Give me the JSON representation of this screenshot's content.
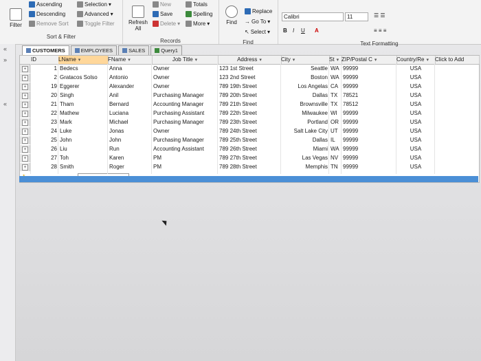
{
  "ribbon": {
    "sort_filter": {
      "filter": "Filter",
      "ascending": "Ascending",
      "descending": "Descending",
      "remove_sort": "Remove Sort",
      "selection": "Selection",
      "advanced": "Advanced",
      "toggle_filter": "Toggle Filter",
      "group": "Sort & Filter"
    },
    "records": {
      "refresh": "Refresh",
      "refresh_all": "All",
      "new": "New",
      "save": "Save",
      "delete": "Delete",
      "totals": "Totals",
      "spelling": "Spelling",
      "more": "More",
      "group": "Records"
    },
    "find": {
      "find": "Find",
      "replace": "Replace",
      "goto": "Go To",
      "select": "Select",
      "group": "Find"
    },
    "text_formatting": {
      "font": "Calibri",
      "size": "11",
      "bold": "B",
      "italic": "I",
      "underline": "U",
      "font_color_letter": "A",
      "group": "Text Formatting"
    }
  },
  "nav": {
    "collapse": "«",
    "arrows": "»",
    "left_mark": "«"
  },
  "tabs": [
    {
      "label": "CUSTOMERS",
      "active": true
    },
    {
      "label": "EMPLOYEES",
      "active": false
    },
    {
      "label": "SALES",
      "active": false
    },
    {
      "label": "Query1",
      "active": false
    }
  ],
  "table": {
    "columns": [
      "ID",
      "LName",
      "FName",
      "Job Title",
      "Address",
      "City",
      "St",
      "ZIP/Postal C",
      "Country/Re",
      "Click to Add"
    ],
    "rows": [
      [
        "1",
        "Bedecs",
        "Anna",
        "Owner",
        "123 1st Street",
        "Seattle",
        "WA",
        "99999",
        "USA"
      ],
      [
        "2",
        "Gratacos Solso",
        "Antonio",
        "Owner",
        "123 2nd Street",
        "Boston",
        "WA",
        "99999",
        "USA"
      ],
      [
        "19",
        "Eggerer",
        "Alexander",
        "Owner",
        "789 19th Street",
        "Los Angelas",
        "CA",
        "99999",
        "USA"
      ],
      [
        "20",
        "Singh",
        "Anil",
        "Purchasing Manager",
        "789 20th Street",
        "Dallas",
        "TX",
        "78521",
        "USA"
      ],
      [
        "21",
        "Tham",
        "Bernard",
        "Accounting Manager",
        "789 21th Street",
        "Brownsville",
        "TX",
        "78512",
        "USA"
      ],
      [
        "22",
        "Mathew",
        "Luciana",
        "Purchasing Assistant",
        "789 22th Street",
        "Milwaukee",
        "WI",
        "99999",
        "USA"
      ],
      [
        "23",
        "Mark",
        "Michael",
        "Purchasing Manager",
        "789 23th Street",
        "Portland",
        "OR",
        "99999",
        "USA"
      ],
      [
        "24",
        "Luke",
        "Jonas",
        "Owner",
        "789 24th Street",
        "Salt Lake City",
        "UT",
        "99999",
        "USA"
      ],
      [
        "25",
        "John",
        "John",
        "Purchasing Manager",
        "789 25th Street",
        "Dallas",
        "IL",
        "99999",
        "USA"
      ],
      [
        "26",
        "Liu",
        "Run",
        "Accounting Assistant",
        "789 26th Street",
        "Miami",
        "WA",
        "99999",
        "USA"
      ],
      [
        "27",
        "Toh",
        "Karen",
        "PM",
        "789 27th Street",
        "Las Vegas",
        "NV",
        "99999",
        "USA"
      ],
      [
        "28",
        "Smith",
        "Roger",
        "PM",
        "789 28th Street",
        "Memphis",
        "TN",
        "99999",
        "USA"
      ]
    ],
    "expand_glyph": "+",
    "new_row_marker": "*"
  },
  "colors": {
    "selection_bar": "#4b8fd6",
    "active_header": "#ffd79a"
  }
}
